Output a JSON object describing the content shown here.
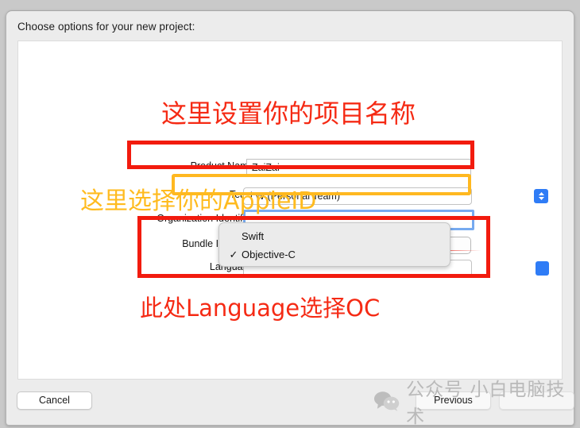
{
  "dialog": {
    "prompt": "Choose options for your new project:"
  },
  "form": {
    "rows": [
      {
        "label": "Product Name:",
        "value": "ZaiZai",
        "kind": "text"
      },
      {
        "label": "Team:",
        "value": "l W (Personal Team)",
        "kind": "combo"
      },
      {
        "label": "Organization Identifier:",
        "value": "",
        "kind": "focused-text"
      },
      {
        "label": "Bundle Identifier:",
        "value": "",
        "kind": "static"
      },
      {
        "label": "Language:",
        "value": "Objective-C",
        "kind": "popup"
      }
    ]
  },
  "language_menu": {
    "options": [
      {
        "label": "Swift",
        "checked": false,
        "check": ""
      },
      {
        "label": "Objective-C",
        "checked": true,
        "check": "✓"
      }
    ]
  },
  "annotations": {
    "title": "这里设置你的项目名称",
    "appleid": "这里选择你的AppleID",
    "language_note": "此处Language选择OC",
    "colors": {
      "red": "#f21b0e",
      "yellow": "#ffb820",
      "arrow_red": "#ee2013"
    }
  },
  "buttons": {
    "cancel": "Cancel",
    "previous": "Previous",
    "next": ""
  },
  "watermark": {
    "text": "公众号 小白电脑技术",
    "icon": "wechat-icon"
  }
}
